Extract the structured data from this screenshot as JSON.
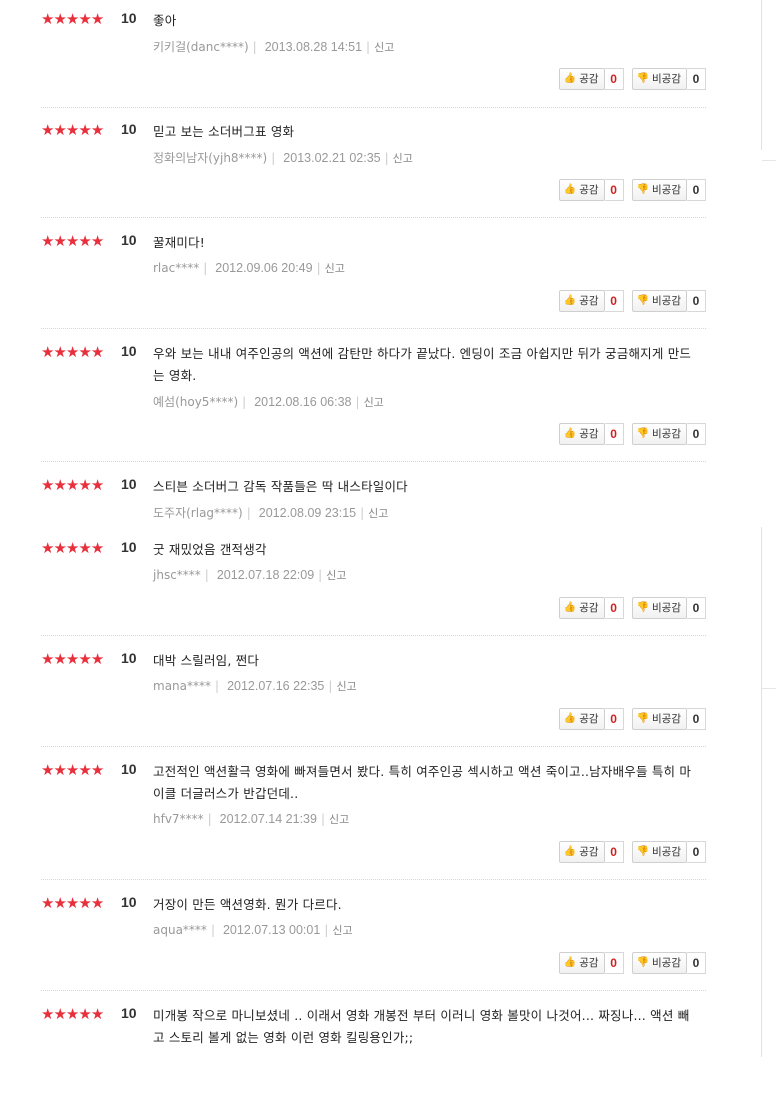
{
  "labels": {
    "like": "공감",
    "dislike": "비공감",
    "report": "신고"
  },
  "colors": {
    "star": "#e8303d",
    "like_count": "#d02020"
  },
  "icons": {
    "like": "thumbs-up-icon",
    "dislike": "thumbs-down-icon",
    "star": "star-icon"
  },
  "reviews": [
    {
      "score": "10",
      "stars": 5,
      "text": "좋아",
      "user": "키키걸(danc****)",
      "date": "2013.08.28 14:51",
      "likes": "0",
      "dislikes": "0"
    },
    {
      "score": "10",
      "stars": 5,
      "text": "믿고 보는 소더버그표 영화",
      "user": "정화의남자(yjh8****)",
      "date": "2013.02.21 02:35",
      "likes": "0",
      "dislikes": "0"
    },
    {
      "score": "10",
      "stars": 5,
      "text": "꿀재미다!",
      "user": "rlac****",
      "date": "2012.09.06 20:49",
      "likes": "0",
      "dislikes": "0"
    },
    {
      "score": "10",
      "stars": 5,
      "text": "우와 보는 내내 여주인공의 액션에 감탄만 하다가 끝났다. 엔딩이 조금 아쉽지만 뒤가 궁금해지게 만드는 영화.",
      "user": "예섬(hoy5****)",
      "date": "2012.08.16 06:38",
      "likes": "0",
      "dislikes": "0"
    },
    {
      "score": "10",
      "stars": 5,
      "text": "스티븐 소더버그 감독 작품들은 딱 내스타일이다",
      "user": "도주자(rlag****)",
      "date": "2012.08.09 23:15"
    },
    {
      "score": "10",
      "stars": 5,
      "text": "굿 재밌었음 갠적생각",
      "user": "jhsc****",
      "date": "2012.07.18 22:09",
      "likes": "0",
      "dislikes": "0"
    },
    {
      "score": "10",
      "stars": 5,
      "text": "대박 스릴러임, 쩐다",
      "user": "mana****",
      "date": "2012.07.16 22:35",
      "likes": "0",
      "dislikes": "0"
    },
    {
      "score": "10",
      "stars": 5,
      "text": "고전적인 액션활극 영화에 빠져들면서 봤다. 특히 여주인공 섹시하고 액션 죽이고..남자배우들 특히 마이클 더글러스가 반갑던데..",
      "user": "hfv7****",
      "date": "2012.07.14 21:39",
      "likes": "0",
      "dislikes": "0"
    },
    {
      "score": "10",
      "stars": 5,
      "text": "거장이 만든 액션영화. 뭔가 다르다.",
      "user": "aqua****",
      "date": "2012.07.13 00:01",
      "likes": "0",
      "dislikes": "0"
    },
    {
      "score": "10",
      "stars": 5,
      "text": "미개봉 작으로 마니보셨네 .. 이래서 영화 개봉전 부터 이러니 영화 볼맛이 나것어... 짜징나... 액션 빼고 스토리 볼게 없는 영화 이런 영화 킬링용인가;;"
    }
  ]
}
